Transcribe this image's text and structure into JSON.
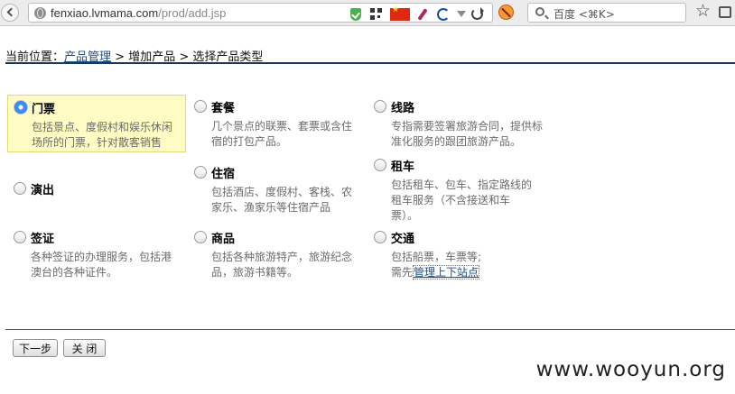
{
  "browser": {
    "url_host": "fenxiao.lvmama.com",
    "url_path": "/prod/add.jsp",
    "search_placeholder": "百度 <⌘K>"
  },
  "breadcrumb": {
    "prefix": "当前位置：",
    "link": "产品管理",
    "rest": " > 增加产品 > 选择产品类型"
  },
  "options": [
    {
      "title": "门票",
      "desc": "包括景点、度假村和娱乐休闲场所的门票，针对散客销售",
      "selected": true
    },
    {
      "title": "演出",
      "desc": "",
      "selected": false
    },
    {
      "title": "签证",
      "desc": "各种签证的办理服务，包括港澳台的各种证件。",
      "selected": false
    },
    {
      "title": "套餐",
      "desc": "几个景点的联票、套票或含住宿的打包产品。",
      "selected": false
    },
    {
      "title": "住宿",
      "desc": "包括酒店、度假村、客栈、农家乐、渔家乐等住宿产品",
      "selected": false
    },
    {
      "title": "商品",
      "desc": "包括各种旅游特产，旅游纪念品，旅游书籍等。",
      "selected": false
    },
    {
      "title": "线路",
      "desc": "专指需要签署旅游合同，提供标准化服务的跟团旅游产品。",
      "selected": false
    },
    {
      "title": "租车",
      "desc": "包括租车、包车、指定路线的租车服务（不含接送和车票）。",
      "selected": false
    },
    {
      "title": "交通",
      "desc_line1": "包括船票，车票等;",
      "desc_prefix": "需先",
      "desc_link": "管理上下站点",
      "selected": false
    }
  ],
  "buttons": {
    "next": "下一步",
    "close": "关 闭"
  },
  "watermark": "www.wooyun.org"
}
